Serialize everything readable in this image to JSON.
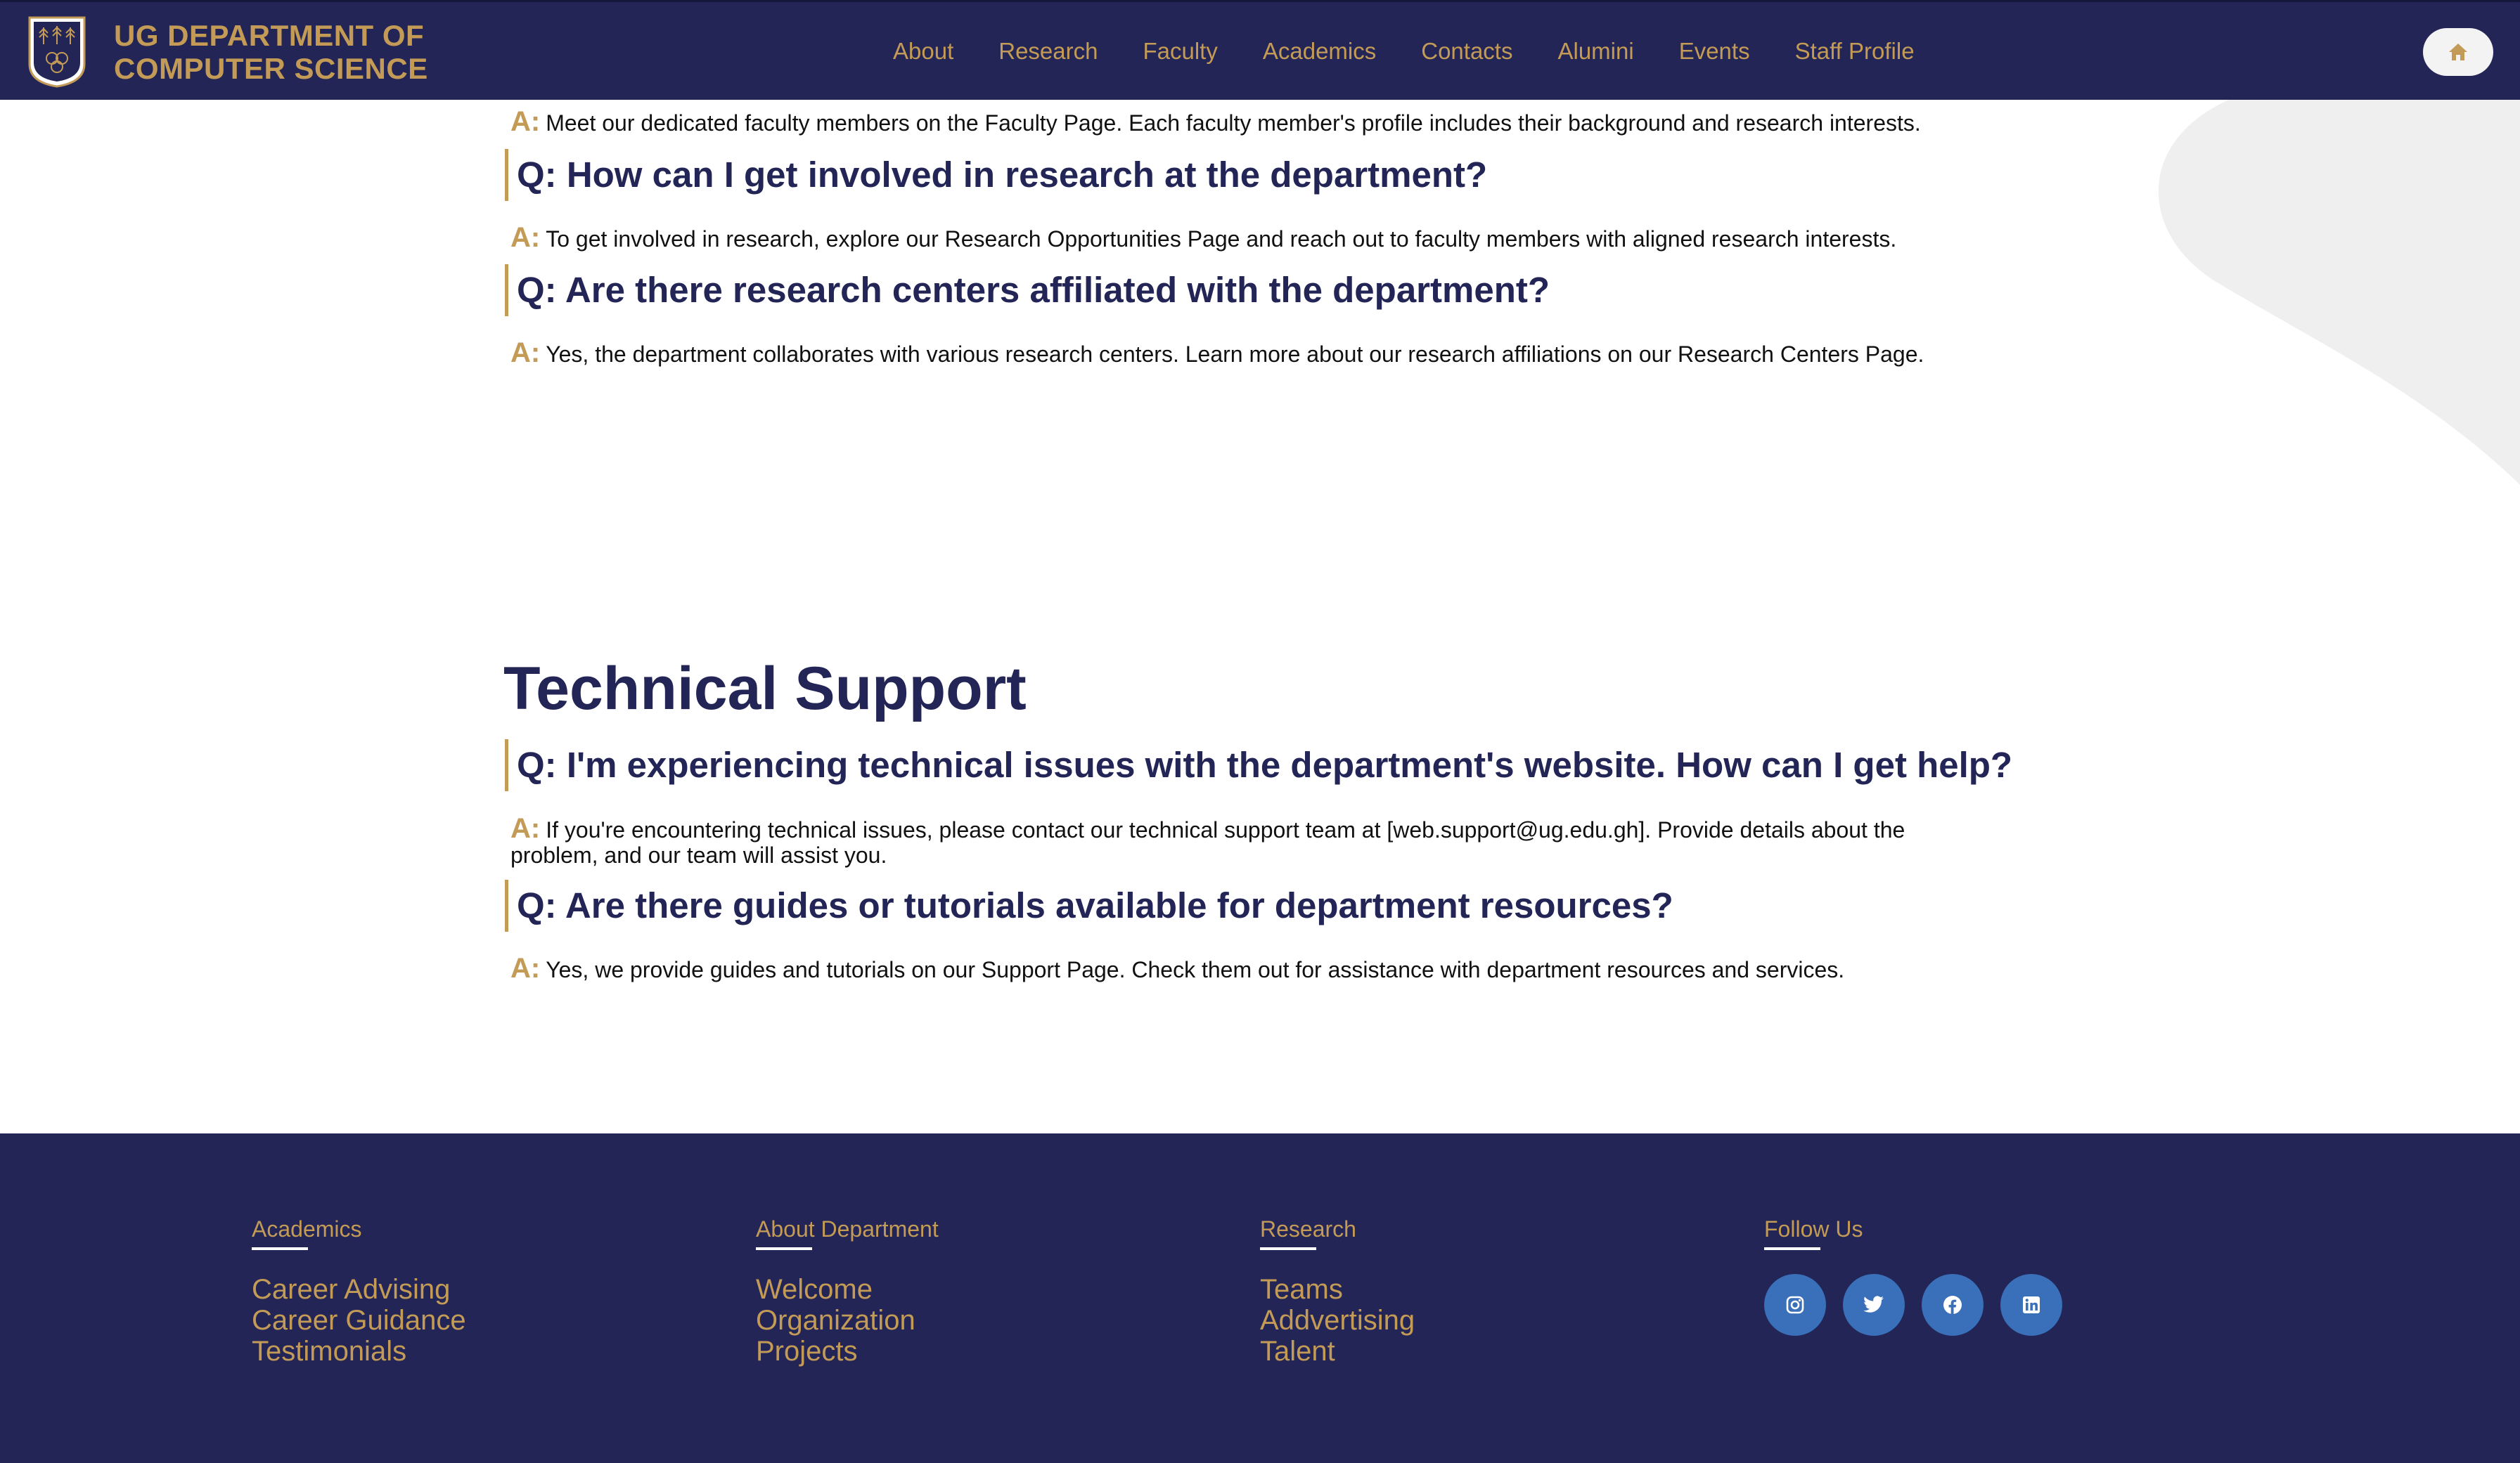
{
  "header": {
    "logo_line1": "UG DEPARTMENT OF",
    "logo_line2": "COMPUTER SCIENCE",
    "nav": [
      "About",
      "Research",
      "Faculty",
      "Academics",
      "Contacts",
      "Alumini",
      "Events",
      "Staff Profile"
    ],
    "home_icon": "home-icon"
  },
  "faq": {
    "a_label": "A:",
    "intro_answer": "Meet our dedicated faculty members on the Faculty Page. Each faculty member's profile includes their background and research interests.",
    "research": [
      {
        "q": "Q: How can I get involved in research at the department?",
        "a": "To get involved in research, explore our Research Opportunities Page and reach out to faculty members with aligned research interests."
      },
      {
        "q": "Q: Are there research centers affiliated with the department?",
        "a": "Yes, the department collaborates with various research centers. Learn more about our research affiliations on our Research Centers Page."
      }
    ],
    "technical_title": "Technical Support",
    "technical": [
      {
        "q": "Q: I'm experiencing technical issues with the department's website. How can I get help?",
        "a": "If you're encountering technical issues, please contact our technical support team at [web.support@ug.edu.gh]. Provide details about the problem, and our team will assist you."
      },
      {
        "q": "Q: Are there guides or tutorials available for department resources?",
        "a": "Yes, we provide guides and tutorials on our Support Page. Check them out for assistance with department resources and services."
      }
    ]
  },
  "footer": {
    "columns": [
      {
        "heading": "Academics",
        "links": [
          "Career Advising",
          "Career Guidance",
          "Testimonials"
        ]
      },
      {
        "heading": "About Department",
        "links": [
          "Welcome",
          "Organization",
          "Projects"
        ]
      },
      {
        "heading": "Research",
        "links": [
          "Teams",
          "Addvertising",
          "Talent"
        ]
      }
    ],
    "follow_heading": "Follow Us",
    "social_icons": [
      "instagram-icon",
      "twitter-icon",
      "facebook-icon",
      "linkedin-icon"
    ]
  },
  "colors": {
    "navy": "#222555",
    "gold": "#c39b57",
    "social_blue": "#3a6fba"
  }
}
